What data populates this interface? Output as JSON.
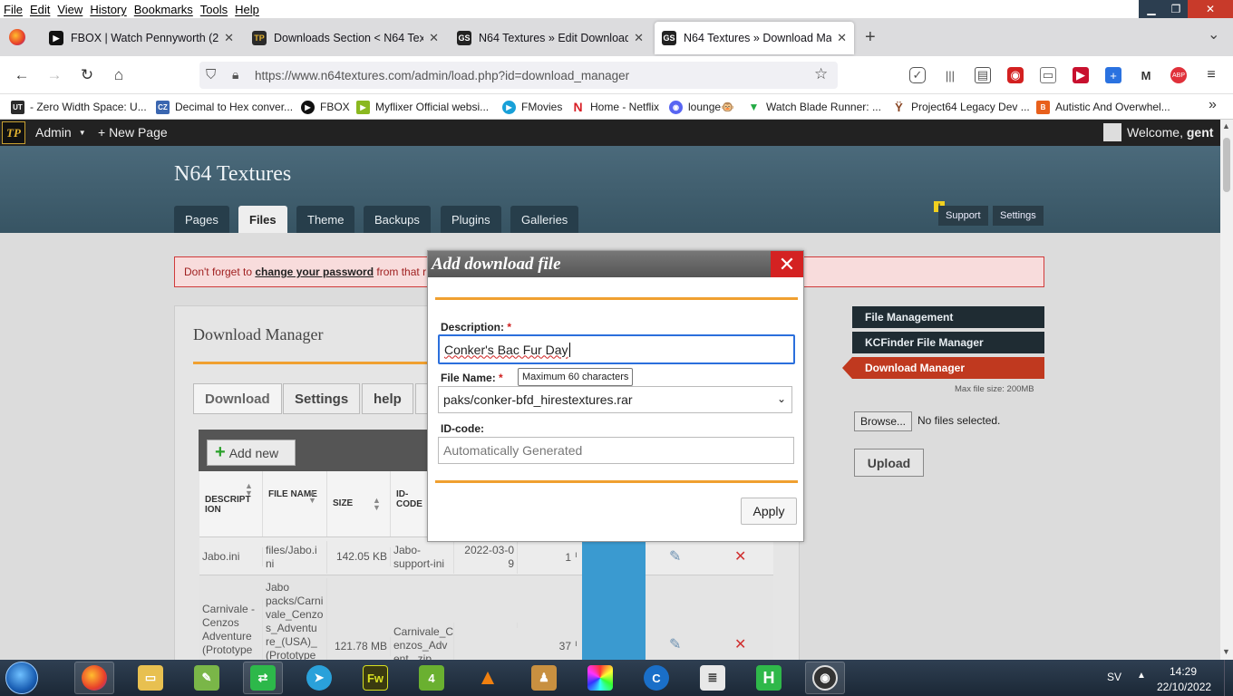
{
  "menu": {
    "file": "File",
    "edit": "Edit",
    "view": "View",
    "history": "History",
    "bookmarks": "Bookmarks",
    "tools": "Tools",
    "help": "Help"
  },
  "tabs": [
    {
      "title": "FBOX | Watch Pennyworth (201",
      "close": "✕"
    },
    {
      "title": "Downloads Section < N64 Textu",
      "close": "✕"
    },
    {
      "title": "N64 Textures » Edit Downloads",
      "close": "✕"
    },
    {
      "title": "N64 Textures » Download Mana",
      "close": "✕"
    }
  ],
  "new_tab": "+",
  "tab_overflow": "⌄",
  "url": "https://www.n64textures.com/admin/load.php?id=download_manager",
  "bookmarks": [
    {
      "label": "- Zero Width Space: U...",
      "badge": "UT",
      "color": "#2b2b2b"
    },
    {
      "label": "Decimal to Hex conver...",
      "badge": "CZ",
      "color": "#3a66b0"
    },
    {
      "label": "FBOX",
      "badge": "▶",
      "color": "#111111"
    },
    {
      "label": "Myflixer Official websi...",
      "badge": "▶",
      "color": "#8ab820"
    },
    {
      "label": "FMovies",
      "badge": "▶",
      "color": "#18a0d8"
    },
    {
      "label": "Home - Netflix",
      "badge": "N",
      "color": "#d81f26"
    },
    {
      "label": "lounge🐵",
      "badge": "◉",
      "color": "#5865f2"
    },
    {
      "label": "Watch Blade Runner: ...",
      "badge": "▼",
      "color": "#22aa44"
    },
    {
      "label": "Project64 Legacy Dev ...",
      "badge": "Ϋ",
      "color": "#884422"
    },
    {
      "label": "Autistic And Overwhel...",
      "badge": "B",
      "color": "#e8601c"
    }
  ],
  "bookmarks_overflow": "»",
  "admin": {
    "logo": "TP",
    "menu_label": "Admin",
    "new_page": "+ New Page",
    "welcome": "Welcome,",
    "user": "gent"
  },
  "site": {
    "title": "N64 Textures",
    "nav": [
      "Pages",
      "Files",
      "Theme",
      "Backups",
      "Plugins",
      "Galleries"
    ],
    "warning_badge": "!",
    "support": "Support",
    "settings": "Settings"
  },
  "alert": {
    "prefix": "Don't forget to",
    "link": "change your password",
    "suffix": "from that r"
  },
  "panel": {
    "title": "Download Manager",
    "tabs": [
      "Download",
      "Settings",
      "help"
    ],
    "add_new": "Add new",
    "columns": [
      "DESCRIPT ION",
      "FILE NAME",
      "SIZE",
      "ID-CODE"
    ],
    "rows": [
      {
        "description": "Jabo.ini",
        "file": "files/Jabo.i ni",
        "size": "142.05 KB",
        "id": "Jabo-support-ini",
        "date": "2022-03-0 9",
        "count": "1"
      },
      {
        "description": "Carnivale - Cenzos Adventure (Prototype",
        "file": "Jabo packs/Carni vale_Cenzo s_Adventu re_(USA)_ (Prototype",
        "size": "121.78 MB",
        "id": "Carnivale_C enzos_Adv ent...zip",
        "date": "",
        "count": "37"
      }
    ],
    "count_suffix": "ı"
  },
  "sidebar": {
    "file_management": "File Management",
    "kcfinder": "KCFinder File Manager",
    "download_manager": "Download Manager",
    "max_size": "Max file size: 200MB",
    "browse": "Browse...",
    "no_files": "No files selected.",
    "upload": "Upload"
  },
  "modal": {
    "title": "Add download file",
    "close": "✕",
    "description_label": "Description:",
    "required_mark": "*",
    "description_value": "Conker's Bac Fur Day",
    "file_name_label": "File Name:",
    "tooltip": "Maximum 60 characters",
    "file_name_value": "paks/conker-bfd_hirestextures.rar",
    "id_code_label": "ID-code:",
    "id_code_placeholder": "Automatically Generated",
    "apply": "Apply"
  },
  "taskbar": {
    "lang": "SV",
    "time": "14:29",
    "date": "22/10/2022"
  },
  "colors": {
    "accent_orange": "#f0a030",
    "danger_red": "#d42222",
    "admin_bar": "#222222",
    "header_teal": "#3f5d6d"
  }
}
